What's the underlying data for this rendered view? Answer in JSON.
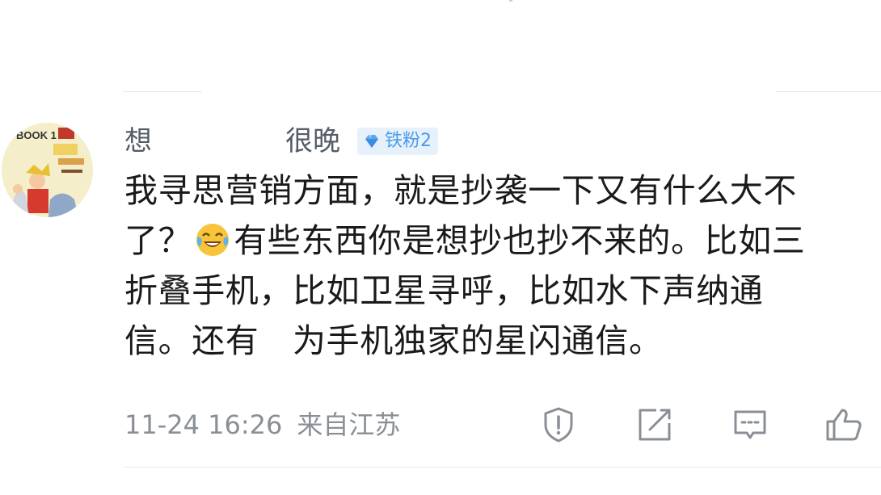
{
  "comment": {
    "username": "想",
    "username_suffix": "很晚",
    "badge": {
      "label": "铁粉2",
      "icon": "diamond-icon",
      "color": "#4a9be8",
      "background": "#e6f1fc"
    },
    "content_lines": [
      "我寻思营销方面，就是抄袭一下又有什么大不",
      "了？",
      "有些东西你是想抄也抄不来的。比如三",
      "折叠手机，比如卫星寻呼，比如水下声纳通",
      "信。还有　为手机独家的星闪通信。"
    ],
    "emoji": "laugh-cry-emoji",
    "timestamp": "11-24 16:26",
    "location": "来自江苏"
  },
  "actions": {
    "report": "report-icon",
    "forward": "share-icon",
    "reply": "comment-icon",
    "like": "like-icon"
  },
  "colors": {
    "text_primary": "#1a1a1a",
    "text_secondary": "#8a8f96",
    "username": "#555c66"
  }
}
